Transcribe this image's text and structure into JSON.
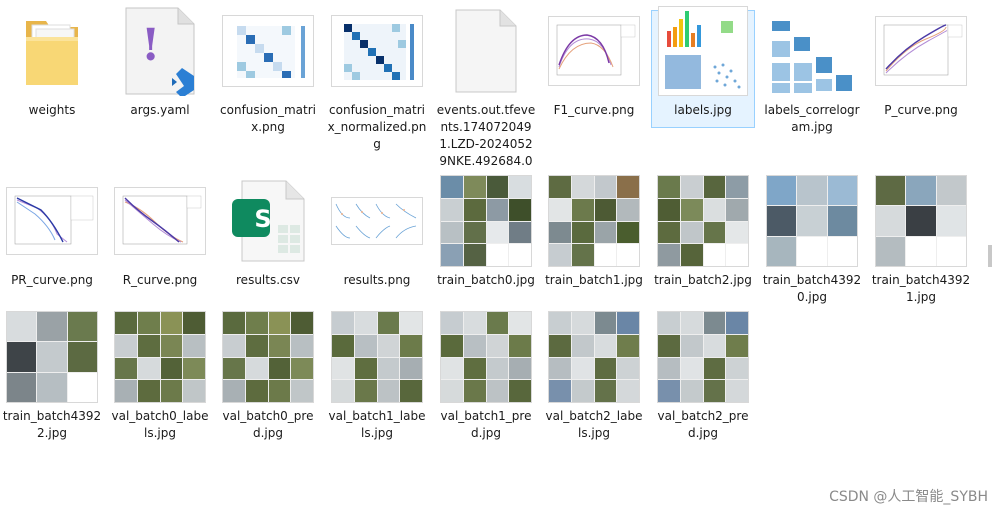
{
  "files": [
    {
      "name": "weights",
      "icon": "folder-icon"
    },
    {
      "name": "args.yaml",
      "icon": "yaml-file-icon"
    },
    {
      "name": "confusion_matrix.png",
      "icon": "image-thumbnail"
    },
    {
      "name": "confusion_matrix_normalized.png",
      "icon": "image-thumbnail"
    },
    {
      "name": "events.out.tfevents.1740720491.LZD-20240529NKE.492684.0",
      "icon": "blank-file-icon"
    },
    {
      "name": "F1_curve.png",
      "icon": "image-thumbnail"
    },
    {
      "name": "labels.jpg",
      "icon": "image-thumbnail",
      "selected": true
    },
    {
      "name": "labels_correlogram.jpg",
      "icon": "image-thumbnail"
    },
    {
      "name": "P_curve.png",
      "icon": "image-thumbnail"
    },
    {
      "name": "PR_curve.png",
      "icon": "image-thumbnail"
    },
    {
      "name": "R_curve.png",
      "icon": "image-thumbnail"
    },
    {
      "name": "results.csv",
      "icon": "spreadsheet-icon"
    },
    {
      "name": "results.png",
      "icon": "image-thumbnail"
    },
    {
      "name": "train_batch0.jpg",
      "icon": "image-thumbnail"
    },
    {
      "name": "train_batch1.jpg",
      "icon": "image-thumbnail"
    },
    {
      "name": "train_batch2.jpg",
      "icon": "image-thumbnail"
    },
    {
      "name": "train_batch43920.jpg",
      "icon": "image-thumbnail"
    },
    {
      "name": "train_batch43921.jpg",
      "icon": "image-thumbnail"
    },
    {
      "name": "train_batch43922.jpg",
      "icon": "image-thumbnail"
    },
    {
      "name": "val_batch0_labels.jpg",
      "icon": "image-thumbnail"
    },
    {
      "name": "val_batch0_pred.jpg",
      "icon": "image-thumbnail"
    },
    {
      "name": "val_batch1_labels.jpg",
      "icon": "image-thumbnail"
    },
    {
      "name": "val_batch1_pred.jpg",
      "icon": "image-thumbnail"
    },
    {
      "name": "val_batch2_labels.jpg",
      "icon": "image-thumbnail"
    },
    {
      "name": "val_batch2_pred.jpg",
      "icon": "image-thumbnail"
    }
  ],
  "yaml_glyph": "!",
  "spreadsheet_glyph": "S",
  "watermark": "CSDN @人工智能_SYBH"
}
